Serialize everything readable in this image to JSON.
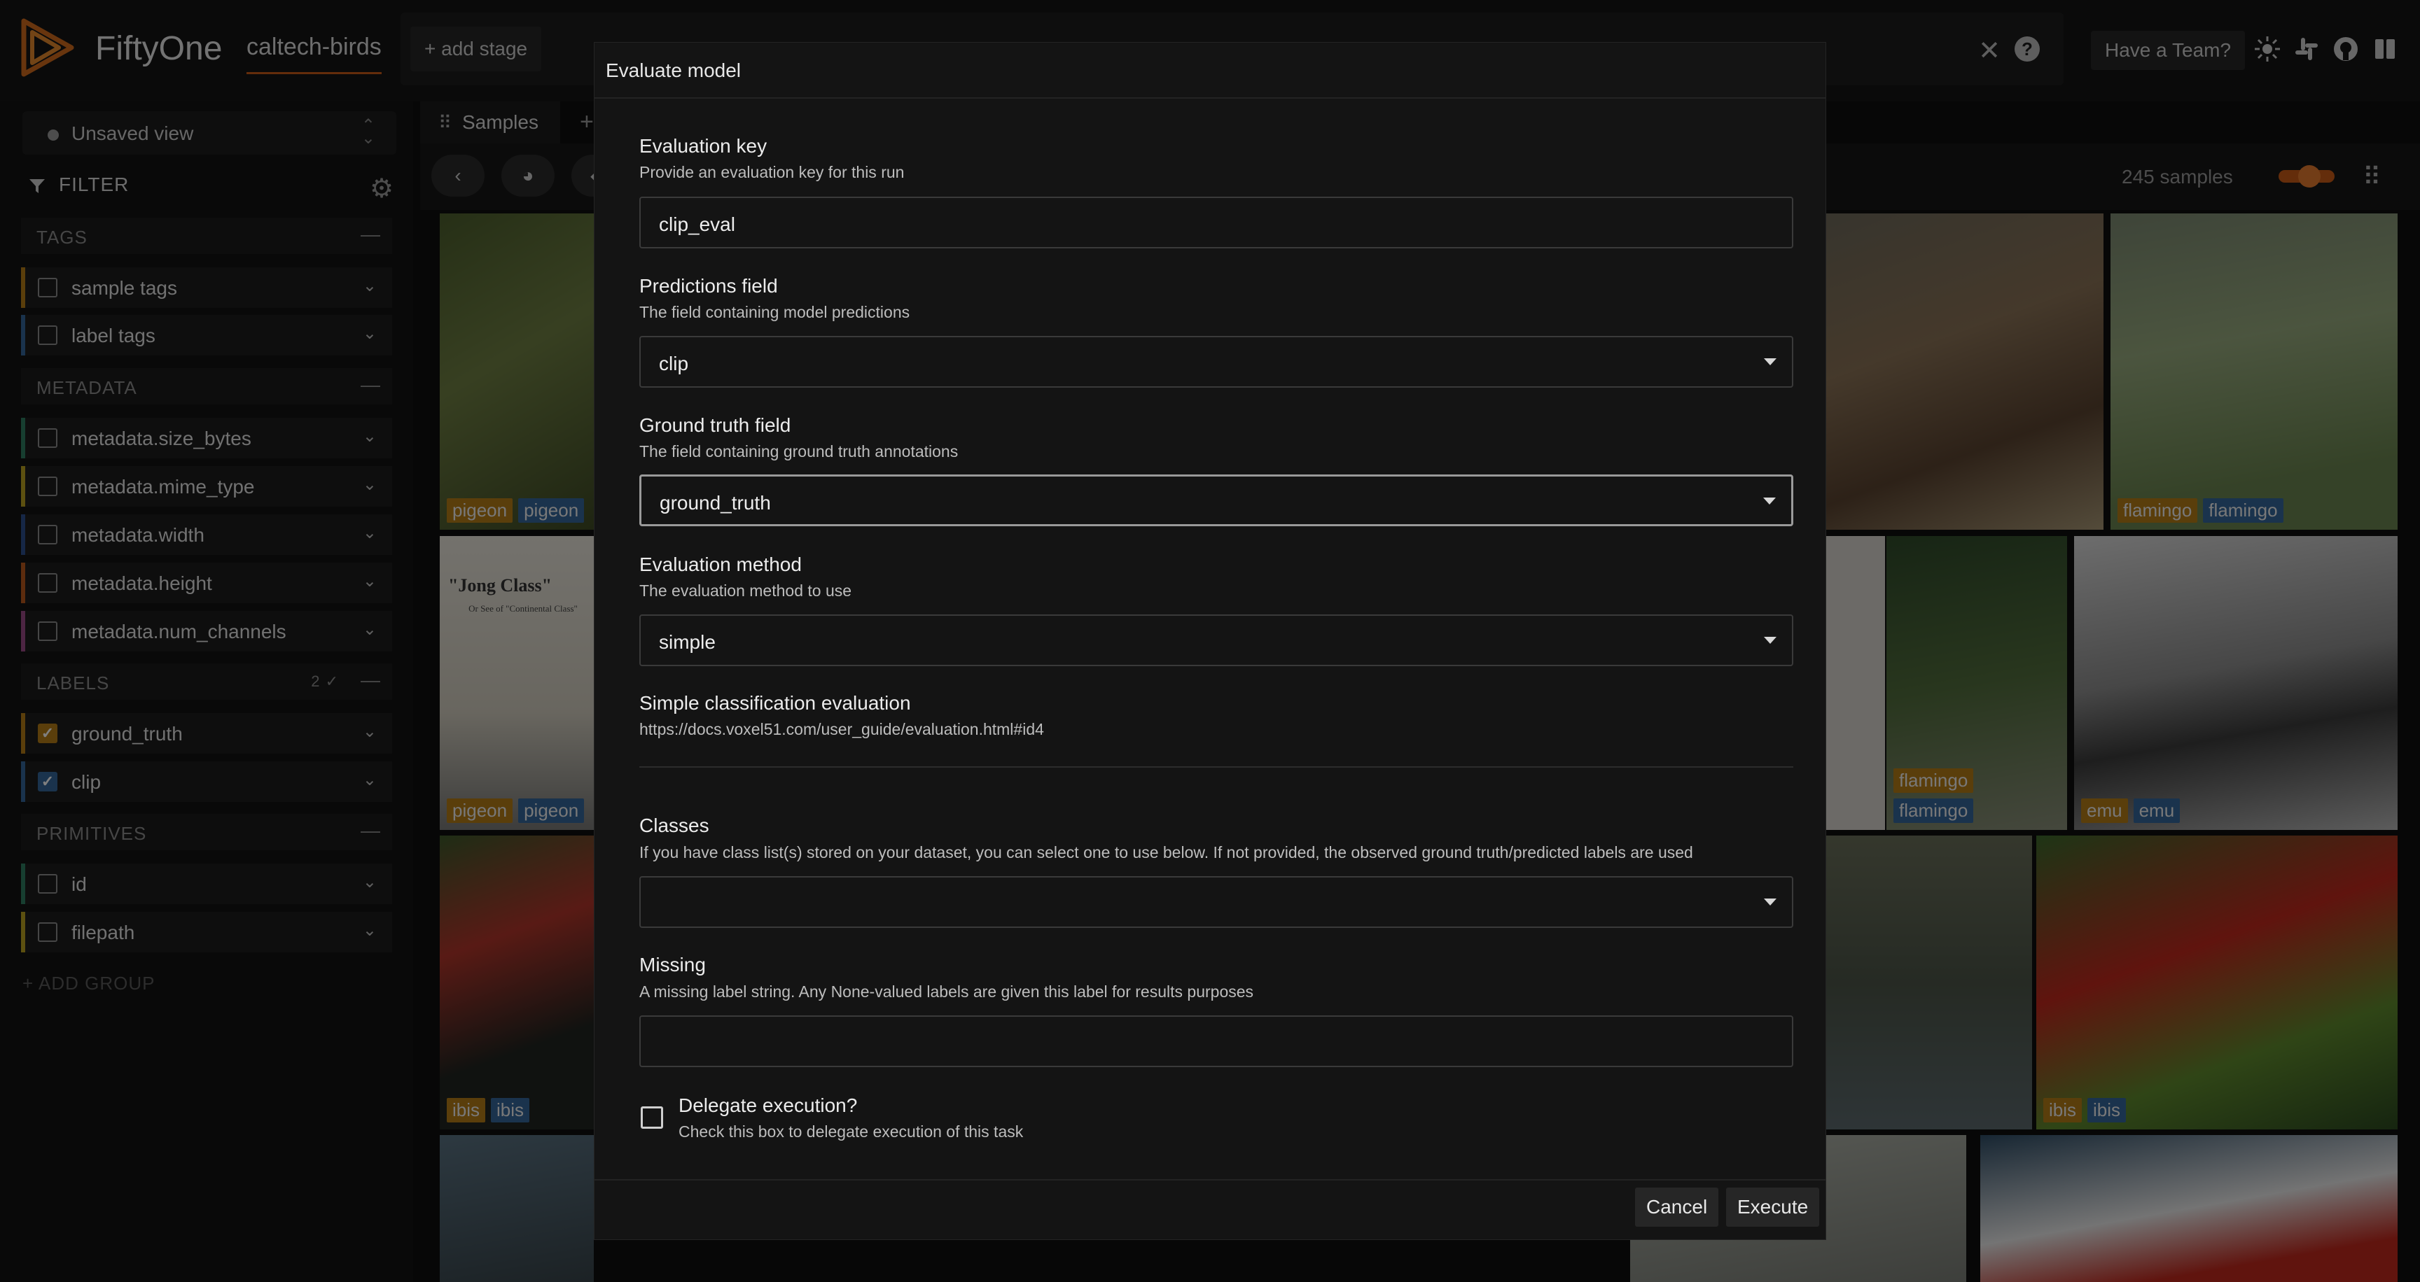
{
  "app": {
    "brand": "FiftyOne",
    "dataset": "caltech-birds",
    "add_stage": "+ add stage",
    "team_button": "Have a Team?",
    "icons": [
      "sun-icon",
      "slack-icon",
      "github-icon",
      "book-icon"
    ]
  },
  "sidebar": {
    "view_select": "Unsaved view",
    "filter_label": "FILTER",
    "groups": {
      "tags": "TAGS",
      "metadata": "METADATA",
      "labels": "LABELS",
      "labels_count": "2",
      "primitives": "PRIMITIVES"
    },
    "fields": {
      "sample_tags": "sample tags",
      "label_tags": "label tags",
      "size_bytes": "metadata.size_bytes",
      "mime_type": "metadata.mime_type",
      "width": "metadata.width",
      "height": "metadata.height",
      "num_channels": "metadata.num_channels",
      "ground_truth": "ground_truth",
      "clip": "clip",
      "id": "id",
      "filepath": "filepath"
    },
    "add_group": "+ ADD GROUP"
  },
  "main": {
    "tab_samples": "Samples",
    "sample_count": "245 samples",
    "tiles": [
      {
        "gt": "pigeon",
        "pred": "pigeon"
      },
      {
        "gt": "flamingo",
        "pred": "flamingo"
      },
      {
        "gt": "pigeon",
        "pred": "pigeon"
      },
      {
        "gt": "flamingo",
        "pred": "flamingo"
      },
      {
        "gt": "emu",
        "pred": "emu"
      },
      {
        "gt": "ibis",
        "pred": "ibis"
      },
      {
        "gt": "ibis",
        "pred": "ibis"
      }
    ],
    "poster_title": "\"Jong Class\"",
    "poster_sub": "Or See of \"Continental Class\""
  },
  "dialog": {
    "title": "Evaluate model",
    "eval_key": {
      "label": "Evaluation key",
      "desc": "Provide an evaluation key for this run",
      "value": "clip_eval"
    },
    "pred_field": {
      "label": "Predictions field",
      "desc": "The field containing model predictions",
      "value": "clip"
    },
    "gt_field": {
      "label": "Ground truth field",
      "desc": "The field containing ground truth annotations",
      "value": "ground_truth"
    },
    "method": {
      "label": "Evaluation method",
      "desc": "The evaluation method to use",
      "value": "simple"
    },
    "simple_eval": {
      "label": "Simple classification evaluation",
      "link": "https://docs.voxel51.com/user_guide/evaluation.html#id4"
    },
    "classes": {
      "label": "Classes",
      "desc": "If you have class list(s) stored on your dataset, you can select one to use below. If not provided, the observed ground truth/predicted labels are used",
      "value": ""
    },
    "missing": {
      "label": "Missing",
      "desc": "A missing label string. Any None-valued labels are given this label for results purposes",
      "value": ""
    },
    "delegate": {
      "label": "Delegate execution?",
      "desc": "Check this box to delegate execution of this task"
    },
    "cancel": "Cancel",
    "execute": "Execute"
  }
}
